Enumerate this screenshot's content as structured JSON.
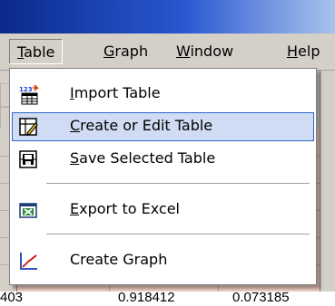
{
  "menubar": {
    "items": [
      {
        "label_ul": "T",
        "label_rest": "able",
        "open": true
      },
      {
        "label_ul": "G",
        "label_rest": "raph"
      },
      {
        "label_ul": "W",
        "label_rest": "indow"
      },
      {
        "label_ul": "H",
        "label_rest": "elp"
      }
    ]
  },
  "dropdown": {
    "items": [
      {
        "label_ul": "I",
        "label_rest": "mport Table",
        "icon": "import-table-icon",
        "icon_badge": "123"
      },
      {
        "label_ul": "C",
        "label_rest": "reate or Edit Table",
        "icon": "edit-table-icon",
        "highlighted": true
      },
      {
        "label_ul": "S",
        "label_rest": "ave Selected Table",
        "icon": "save-table-icon"
      },
      {
        "label_ul": "E",
        "label_rest": "xport to Excel",
        "icon": "excel-export-icon"
      },
      {
        "label_plain": "Create Graph",
        "icon": "graph-icon"
      }
    ]
  },
  "background_table": {
    "visible_values": [
      "403",
      "0.918412",
      "0.073185"
    ]
  },
  "colors": {
    "highlight_bg": "#cfdcf3",
    "highlight_border": "#3166c9",
    "menubar_bg": "#d4d0c8",
    "table_bg": "#f3cfc2"
  }
}
